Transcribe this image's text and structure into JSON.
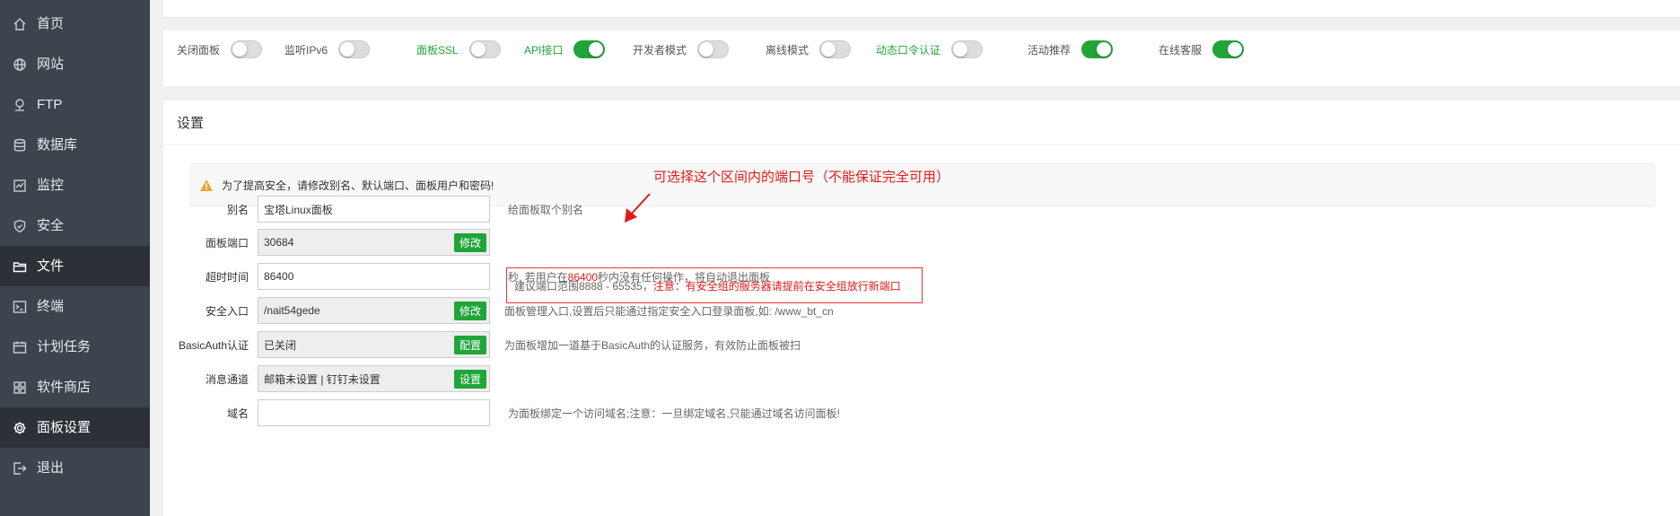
{
  "sidebar": {
    "items": [
      {
        "label": "首页",
        "icon": "home-icon",
        "active": false
      },
      {
        "label": "网站",
        "icon": "globe-icon",
        "active": false
      },
      {
        "label": "FTP",
        "icon": "ftp-icon",
        "active": false
      },
      {
        "label": "数据库",
        "icon": "database-icon",
        "active": false
      },
      {
        "label": "监控",
        "icon": "monitor-icon",
        "active": false
      },
      {
        "label": "安全",
        "icon": "shield-icon",
        "active": false
      },
      {
        "label": "文件",
        "icon": "folder-icon",
        "active": true
      },
      {
        "label": "终端",
        "icon": "terminal-icon",
        "active": false
      },
      {
        "label": "计划任务",
        "icon": "calendar-icon",
        "active": false
      },
      {
        "label": "软件商店",
        "icon": "apps-icon",
        "active": false
      },
      {
        "label": "面板设置",
        "icon": "gear-icon",
        "active": true
      },
      {
        "label": "退出",
        "icon": "logout-icon",
        "active": false
      }
    ]
  },
  "toggles": [
    {
      "label": "关闭面板",
      "on": false,
      "green": false
    },
    {
      "label": "监听IPv6",
      "on": false,
      "green": false
    },
    {
      "label": "面板SSL",
      "on": false,
      "green": true
    },
    {
      "label": "API接口",
      "on": true,
      "green": true
    },
    {
      "label": "开发者模式",
      "on": false,
      "green": false
    },
    {
      "label": "离线模式",
      "on": false,
      "green": false
    },
    {
      "label": "动态口令认证",
      "on": false,
      "green": true
    },
    {
      "label": "活动推荐",
      "on": true,
      "green": false
    },
    {
      "label": "在线客服",
      "on": true,
      "green": false
    }
  ],
  "settings": {
    "title": "设置",
    "warning": "为了提高安全，请修改别名、默认端口、面板用户和密码!",
    "alias": {
      "label": "别名",
      "value": "宝塔Linux面板",
      "help": "给面板取个别名"
    },
    "port": {
      "label": "面板端口",
      "value": "30684",
      "button": "修改",
      "help_prefix": "建议端口范围8888 - 65535，",
      "help_red": "注意：有安全组的服务器请提前在安全组放行新端口"
    },
    "timeout": {
      "label": "超时时间",
      "value": "86400",
      "help_prefix": "秒, 若用户在",
      "help_red": "86400",
      "help_suffix": "秒内没有任何操作，将自动退出面板"
    },
    "entry": {
      "label": "安全入口",
      "value": "/nait54gede",
      "button": "修改",
      "help": "面板管理入口,设置后只能通过指定安全入口登录面板,如: /www_bt_cn"
    },
    "basicauth": {
      "label": "BasicAuth认证",
      "value": "已关闭",
      "button": "配置",
      "help": "为面板增加一道基于BasicAuth的认证服务，有效防止面板被扫"
    },
    "notify": {
      "label": "消息通道",
      "value": "邮箱未设置 | 钉钉未设置",
      "button": "设置"
    },
    "domain": {
      "label": "域名",
      "value": "",
      "help": "为面板绑定一个访问域名;注意：一旦绑定域名,只能通过域名访问面板!"
    }
  },
  "annotation": {
    "text": "可选择这个区间内的端口号（不能保证完全可用）"
  },
  "colors": {
    "sidebar": "#3c444d",
    "sidebar_active": "#2c3138",
    "accent": "#20a53a",
    "red": "#e41a1a"
  }
}
